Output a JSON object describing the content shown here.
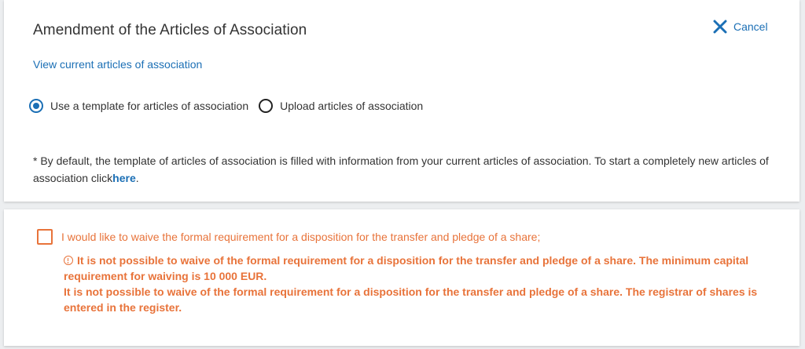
{
  "header": {
    "title": "Amendment of the Articles of Association",
    "cancel_label": "Cancel"
  },
  "view_link": "View current articles of association",
  "radio_options": [
    {
      "label": "Use a template for articles of association",
      "checked": true
    },
    {
      "label": "Upload articles of association",
      "checked": false
    }
  ],
  "note": {
    "text": "* By default, the template of articles of association is filled with information from your current articles of association. To start a completely new articles of association click",
    "link": "here",
    "suffix": "."
  },
  "waiver": {
    "checkbox_label": "I would like to waive the formal requirement for a disposition for the transfer and pledge of a share;",
    "checked": false,
    "errors": [
      "It is not possible to waive of the formal requirement for a disposition for the transfer and pledge of a share. The minimum capital requirement for waiving is 10 000 EUR.",
      "It is not possible to waive of the formal requirement for a disposition for the transfer and pledge of a share. The registrar of shares is entered in the register."
    ]
  },
  "colors": {
    "accent": "#1b6fb5",
    "warning": "#e8733a",
    "background": "#eceef0"
  },
  "icons": {
    "cancel": "close-icon",
    "error": "error-circle-icon"
  }
}
